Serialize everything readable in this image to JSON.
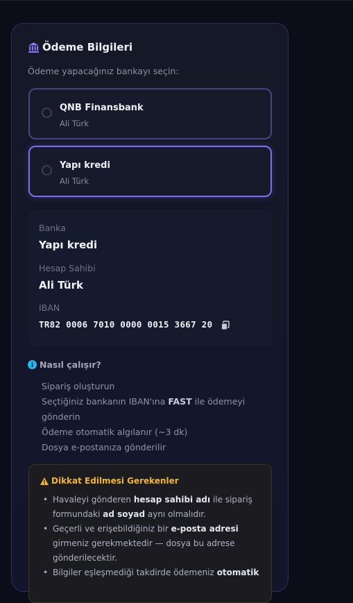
{
  "payment": {
    "title": "Ödeme Bilgileri",
    "subtitle": "Ödeme yapacağınız bankayı seçin:",
    "banks": [
      {
        "name": "QNB Finansbank",
        "owner": "Ali Türk",
        "selected": false
      },
      {
        "name": "Yapı kredi",
        "owner": "Ali Türk",
        "selected": true
      }
    ],
    "details": {
      "bank_label": "Banka",
      "bank_value": "Yapı kredi",
      "holder_label": "Hesap Sahibi",
      "holder_value": "Ali Türk",
      "iban_label": "IBAN",
      "iban_value": "TR82 0006 7010 0000 0015 3667 20"
    }
  },
  "how": {
    "title": "Nasıl çalışır?",
    "step1": "Sipariş oluşturun",
    "step2_pre": "Seçtiğiniz bankanın IBAN'ına",
    "step2_bold": "FAST",
    "step2_post": "ile ödemeyi gönderin",
    "step3": "Ödeme otomatik algılanır (~3 dk)",
    "step4": "Dosya e-postanıza gönderilir"
  },
  "warnings": {
    "title": "Dikkat Edilmesi Gerekenler",
    "w1_pre": "Havaleyi gönderen",
    "w1_b1": "hesap sahibi adı",
    "w1_mid": "ile sipariş formundaki",
    "w1_b2": "ad soyad",
    "w1_post": "aynı olmalıdır.",
    "w2_pre": "Geçerli ve erişebildiğiniz bir",
    "w2_b": "e-posta adresi",
    "w2_post": "girmeniz gerekmektedir — dosya bu adrese gönderilecektir.",
    "w3_pre": "Bilgiler eşleşmediği takdirde ödemeniz",
    "w3_b": "otomatik"
  },
  "colors": {
    "accent": "#7c6ff0",
    "warning": "#f2b630",
    "info": "#22b8f0"
  }
}
